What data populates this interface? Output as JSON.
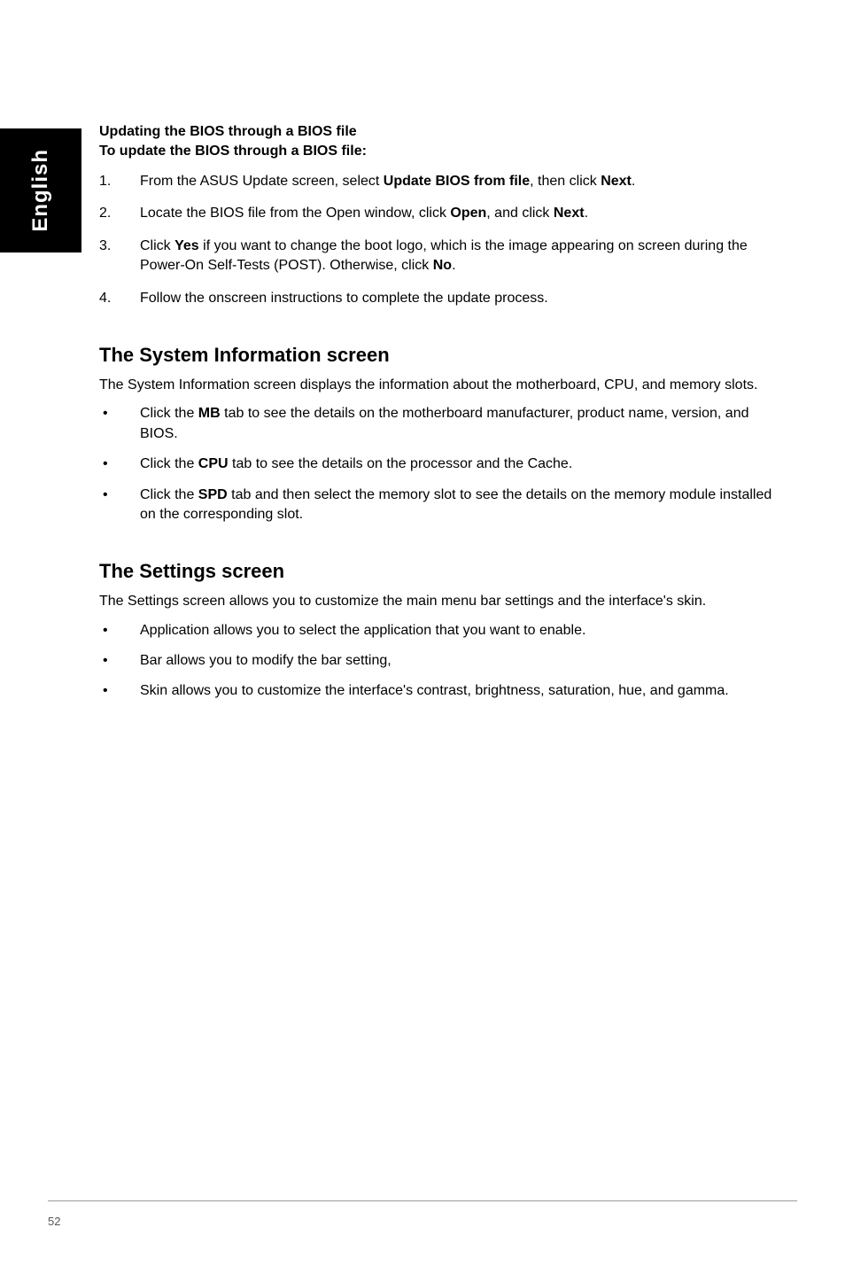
{
  "sideTab": "English",
  "section1": {
    "heading1": "Updating the BIOS through a BIOS file",
    "heading2": "To update the BIOS through a BIOS file:",
    "steps": [
      {
        "num": "1.",
        "pre": "From the ASUS Update screen, select ",
        "b1": "Update BIOS from file",
        "mid": ", then click ",
        "b2": "Next",
        "post": "."
      },
      {
        "num": "2.",
        "pre": "Locate the BIOS file from the Open window, click ",
        "b1": "Open",
        "mid": ", and click ",
        "b2": "Next",
        "post": "."
      },
      {
        "num": "3.",
        "pre": "Click ",
        "b1": "Yes",
        "mid": " if you want to change the boot logo, which is the image appearing on screen during the Power-On Self-Tests (POST). Otherwise, click ",
        "b2": "No",
        "post": "."
      },
      {
        "num": "4.",
        "pre": "Follow the onscreen instructions to complete the update process.",
        "b1": "",
        "mid": "",
        "b2": "",
        "post": ""
      }
    ]
  },
  "section2": {
    "title": "The System Information screen",
    "intro": "The System Information screen displays the information about the motherboard, CPU, and memory slots.",
    "bullets": [
      {
        "pre": "Click the ",
        "b": "MB",
        "post": " tab to see the details on the motherboard manufacturer, product name, version, and BIOS."
      },
      {
        "pre": "Click the ",
        "b": "CPU",
        "post": " tab to see the details on the processor and the Cache."
      },
      {
        "pre": "Click the ",
        "b": "SPD",
        "post": " tab and then select the memory slot to see the details on the memory module installed on the corresponding slot."
      }
    ]
  },
  "section3": {
    "title": "The Settings screen",
    "intro": "The Settings screen allows you to customize the main menu bar settings and the interface's skin.",
    "bullets": [
      "Application allows you to select the application that you want to enable.",
      "Bar allows you to modify the bar setting,",
      "Skin allows you to customize the interface's contrast, brightness, saturation, hue, and gamma."
    ]
  },
  "pageNumber": "52"
}
